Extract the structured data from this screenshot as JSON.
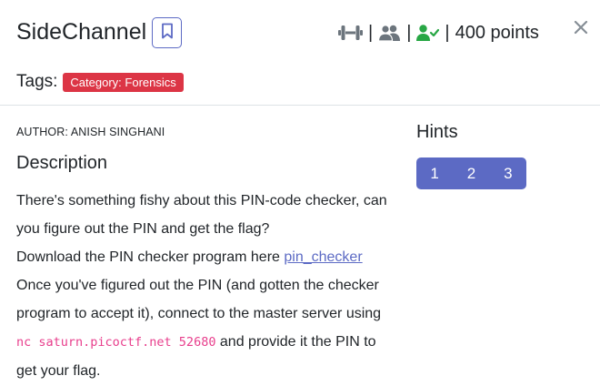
{
  "challenge": {
    "title": "SideChannel",
    "points": "400 points",
    "tags_label": "Tags:",
    "tags": [
      "Category: Forensics"
    ],
    "author": "AUTHOR: ANISH SINGHANI",
    "description_heading": "Description",
    "description": {
      "line1": "There's something fishy about this PIN-code checker, can you figure out the PIN and get the flag?",
      "download_prefix": "Download the PIN checker program here ",
      "download_link": "pin_checker",
      "line3": "Once you've figured out the PIN (and gotten the checker program to accept it), connect to the master server using ",
      "command": "nc saturn.picoctf.net 52680",
      "line3_suffix": " and provide it the PIN to get your flag."
    }
  },
  "separator": "|",
  "hints": {
    "title": "Hints",
    "items": [
      "1",
      "2",
      "3"
    ]
  },
  "icons": {
    "bookmark": "bookmark-icon",
    "difficulty": "dumbbell-icon",
    "solvers": "users-icon",
    "solved": "user-check-icon",
    "close": "close-icon"
  },
  "colors": {
    "accent": "#5c6ac4",
    "tag": "#dc3545",
    "solved": "#28a745",
    "icon_gray": "#6c757d",
    "code": "#e83e8c"
  }
}
